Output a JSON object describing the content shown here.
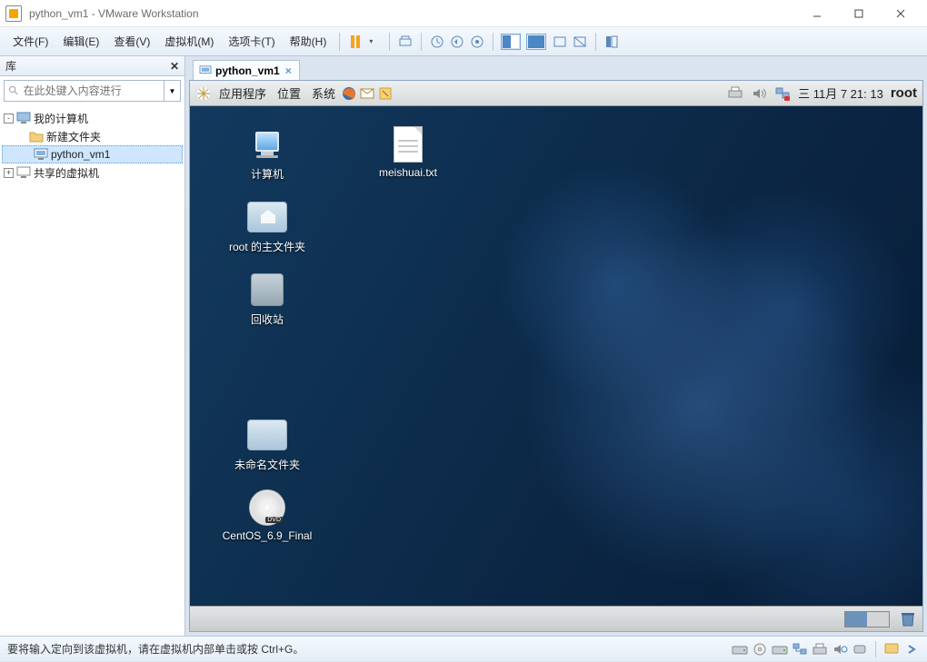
{
  "window": {
    "title": "python_vm1 - VMware Workstation"
  },
  "menus": {
    "file": "文件(F)",
    "edit": "编辑(E)",
    "view": "查看(V)",
    "vm": "虚拟机(M)",
    "tabs": "选项卡(T)",
    "help": "帮助(H)"
  },
  "library": {
    "title": "库",
    "search_placeholder": "在此处键入内容进行",
    "nodes": {
      "my_computer": "我的计算机",
      "new_folder": "新建文件夹",
      "vm1": "python_vm1",
      "shared": "共享的虚拟机"
    }
  },
  "tab": {
    "label": "python_vm1"
  },
  "guest": {
    "menu": {
      "apps": "应用程序",
      "places": "位置",
      "system": "系统"
    },
    "clock": "三 11月  7 21: 13",
    "user": "root",
    "icons": {
      "computer": "计算机",
      "file1": "meishuai.txt",
      "home": "root 的主文件夹",
      "trash": "回收站",
      "unnamed": "未命名文件夹",
      "dvd": "CentOS_6.9_Final"
    }
  },
  "status": {
    "text": "要将输入定向到该虚拟机，请在虚拟机内部单击或按 Ctrl+G。"
  }
}
